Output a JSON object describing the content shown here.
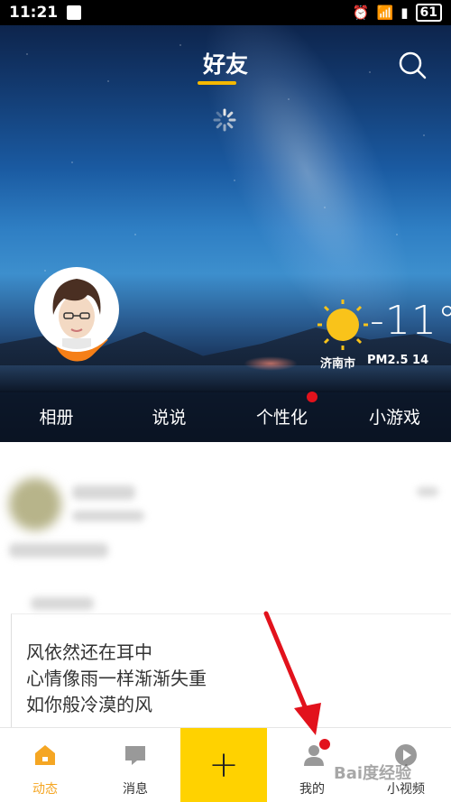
{
  "status_bar": {
    "time": "11:21",
    "battery": "61"
  },
  "header": {
    "title": "好友"
  },
  "weather": {
    "temperature": "-11°",
    "city": "济南市",
    "pm": "PM2.5  14"
  },
  "hero_tabs": [
    {
      "label": "相册"
    },
    {
      "label": "说说"
    },
    {
      "label": "个性化"
    },
    {
      "label": "小游戏"
    }
  ],
  "post": {
    "lines": [
      "风依然还在耳中",
      "心情像雨一样渐渐失重",
      "如你般冷漠的风"
    ]
  },
  "bottom_nav": [
    {
      "label": "动态"
    },
    {
      "label": "消息"
    },
    {
      "label": "+"
    },
    {
      "label": "我的"
    },
    {
      "label": "小视频"
    }
  ],
  "watermark": "Bai度经验",
  "colors": {
    "accent": "#f5b800",
    "plus_bg": "#ffd200",
    "active_nav": "#f5a623",
    "badge": "#e2121c"
  }
}
